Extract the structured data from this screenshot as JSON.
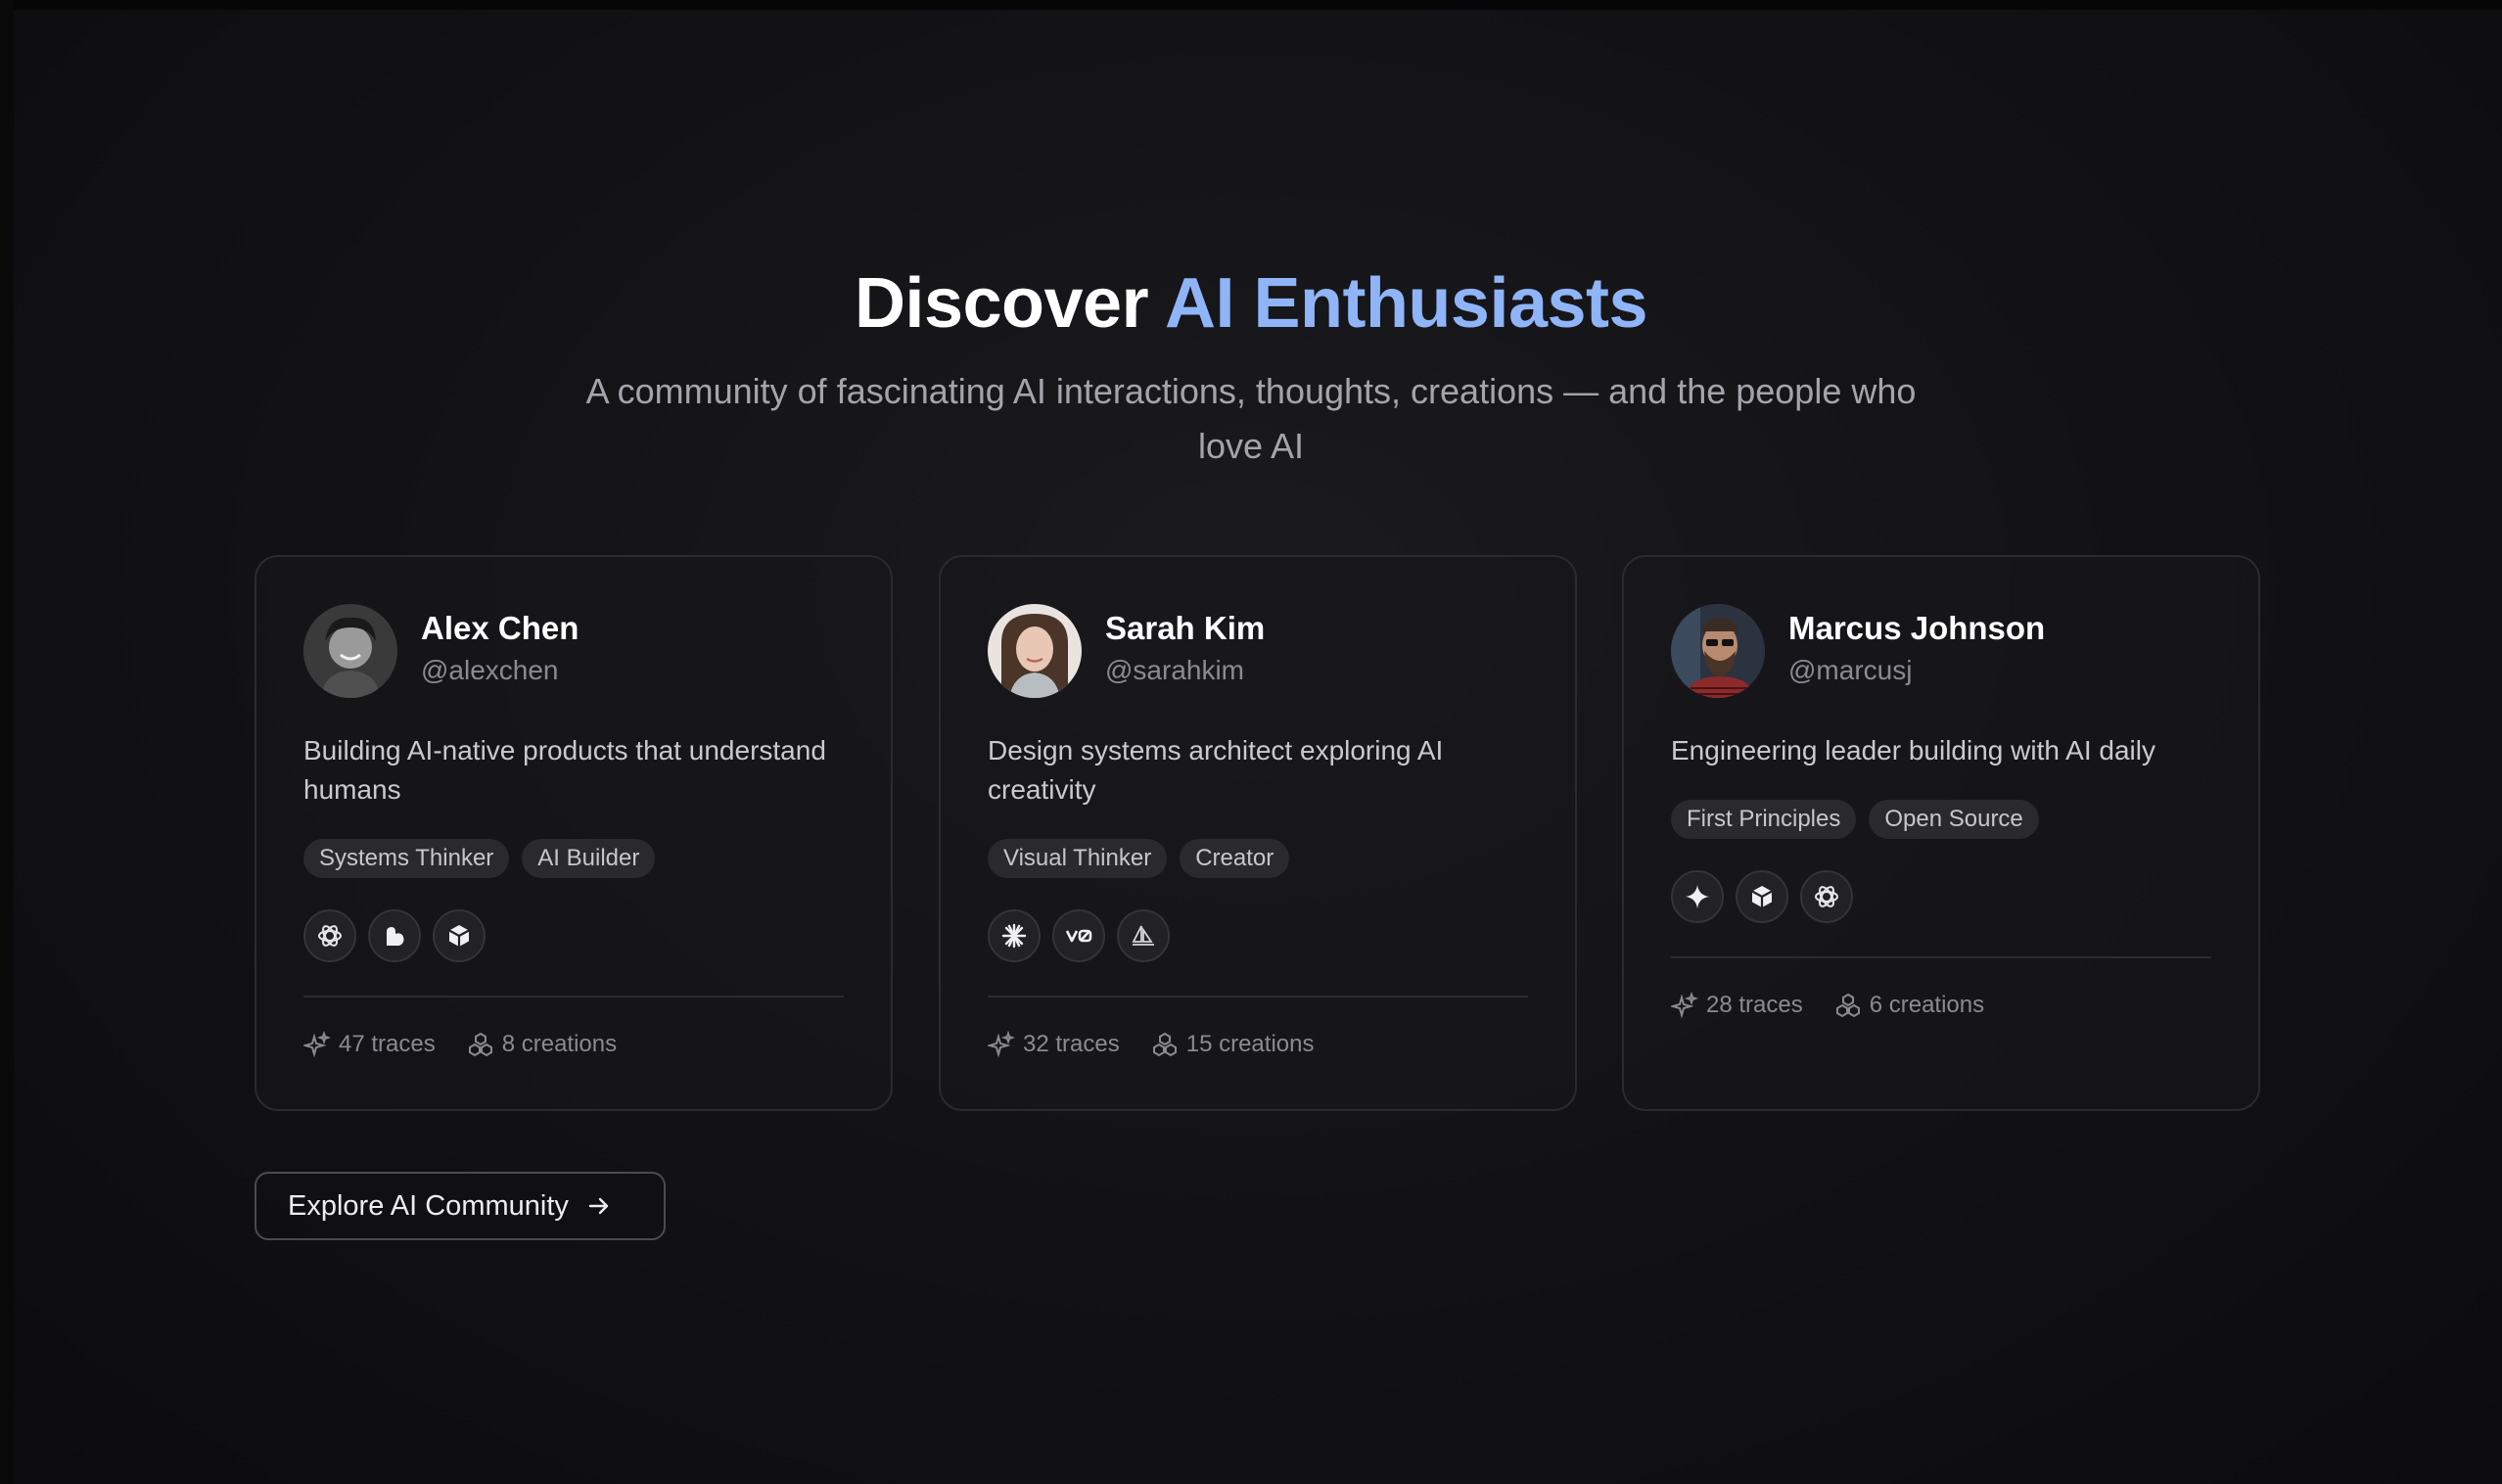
{
  "hero": {
    "title_plain": "Discover",
    "title_accent": "AI Enthusiasts",
    "subtitle": "A community of fascinating AI interactions, thoughts, creations — and the people who love AI"
  },
  "colors": {
    "accent": "#8fb4f8",
    "background": "#0d0d0f",
    "card_border": "#2a2a2f",
    "tag_bg": "#2a2a2e"
  },
  "profiles": [
    {
      "name": "Alex Chen",
      "handle": "@alexchen",
      "bio": "Building AI-native products that understand humans",
      "tags": [
        "Systems Thinker",
        "AI Builder"
      ],
      "tools": [
        "openai-icon",
        "claude-blob-icon",
        "cube-icon"
      ],
      "traces": "47 traces",
      "creations": "8 creations"
    },
    {
      "name": "Sarah Kim",
      "handle": "@sarahkim",
      "bio": "Design systems architect exploring AI creativity",
      "tags": [
        "Visual Thinker",
        "Creator"
      ],
      "tools": [
        "anthropic-burst-icon",
        "v0-icon",
        "sailboat-icon"
      ],
      "traces": "32 traces",
      "creations": "15 creations"
    },
    {
      "name": "Marcus Johnson",
      "handle": "@marcusj",
      "bio": "Engineering leader building with AI daily",
      "tags": [
        "First Principles",
        "Open Source"
      ],
      "tools": [
        "sparkle-icon",
        "cube-icon",
        "openai-icon"
      ],
      "traces": "28 traces",
      "creations": "6 creations"
    }
  ],
  "cta": {
    "label": "Explore AI Community",
    "icon": "arrow-right-icon"
  }
}
